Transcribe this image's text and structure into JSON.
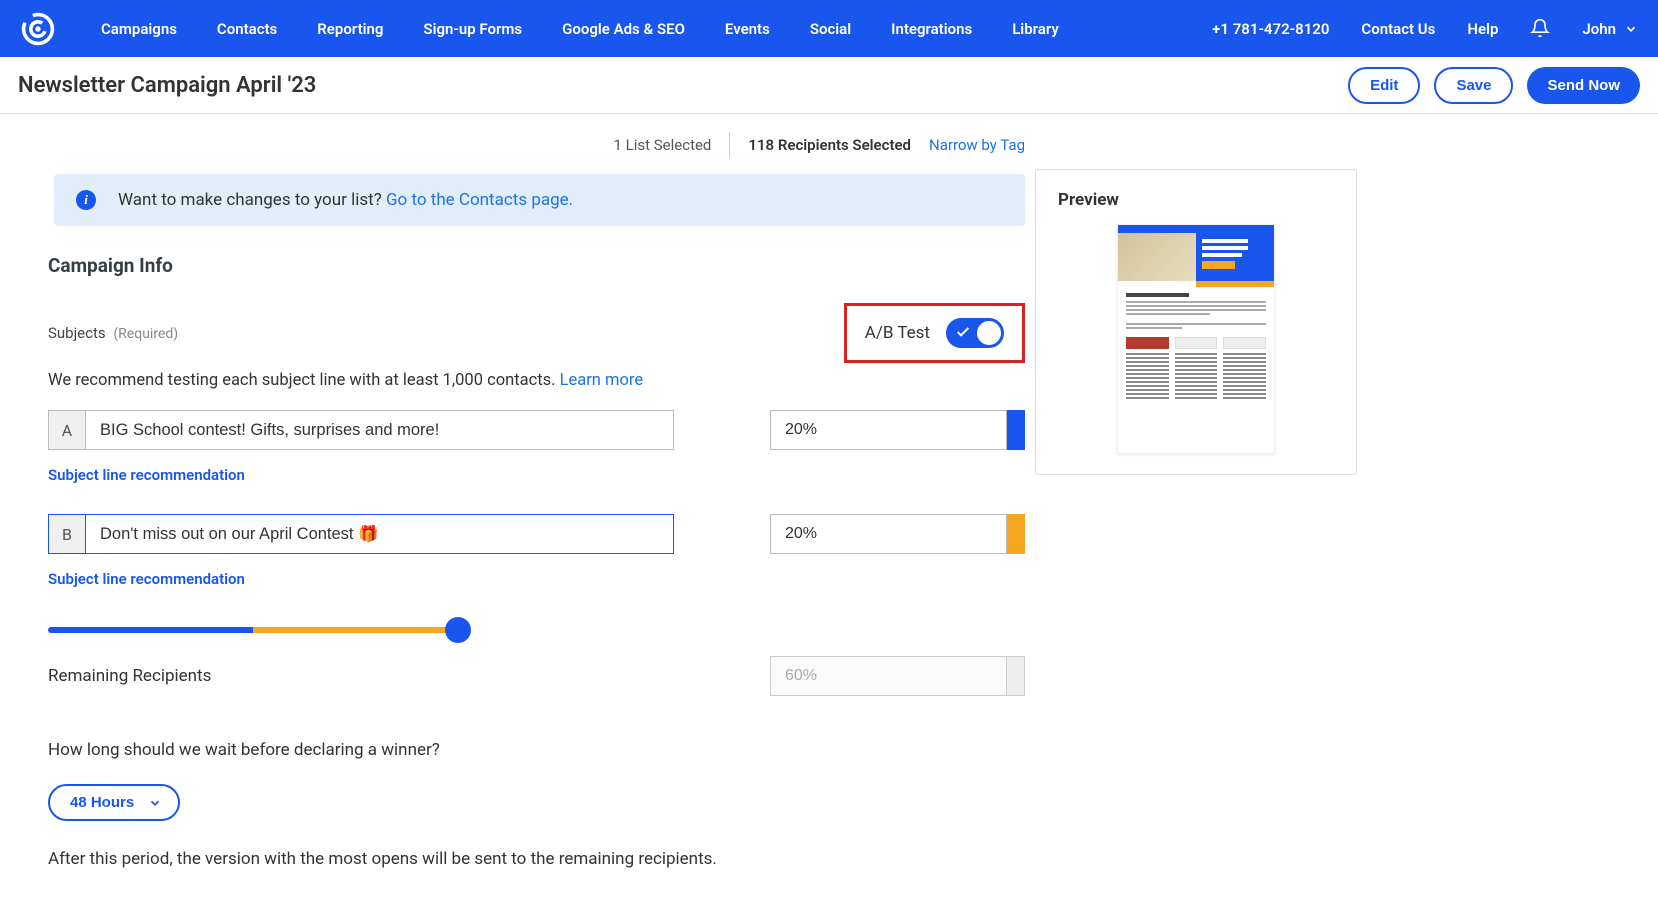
{
  "nav": {
    "items": [
      "Campaigns",
      "Contacts",
      "Reporting",
      "Sign-up Forms",
      "Google Ads & SEO",
      "Events",
      "Social",
      "Integrations",
      "Library"
    ],
    "phone": "+1 781-472-8120",
    "contact": "Contact Us",
    "help": "Help",
    "user": "John"
  },
  "page": {
    "title": "Newsletter Campaign April '23",
    "edit": "Edit",
    "save": "Save",
    "send": "Send Now"
  },
  "recipients": {
    "lists": "1 List Selected",
    "count": "118 Recipients Selected",
    "narrow": "Narrow by Tag"
  },
  "banner": {
    "text": "Want to make changes to your list? ",
    "link": "Go to the Contacts page."
  },
  "campaign": {
    "heading": "Campaign Info",
    "subjects_label": "Subjects",
    "required": "(Required)",
    "abtest_label": "A/B Test",
    "recommend_text": "We recommend testing each subject line with at least 1,000 contacts. ",
    "learn_more": "Learn more",
    "subject_a_prefix": "A",
    "subject_a": "BIG School contest! Gifts, surprises and more!",
    "subject_a_pct": "20%",
    "subject_b_prefix": "B",
    "subject_b": "Don't miss out on our April Contest 🎁",
    "subject_b_pct": "20%",
    "line_rec": "Subject line recommendation",
    "remaining_label": "Remaining Recipients",
    "remaining_pct": "60%",
    "winner_q": "How long should we wait before declaring a winner?",
    "duration": "48 Hours",
    "after_text": "After this period, the version with the most opens will be sent to the remaining recipients."
  },
  "preview": {
    "title": "Preview"
  }
}
